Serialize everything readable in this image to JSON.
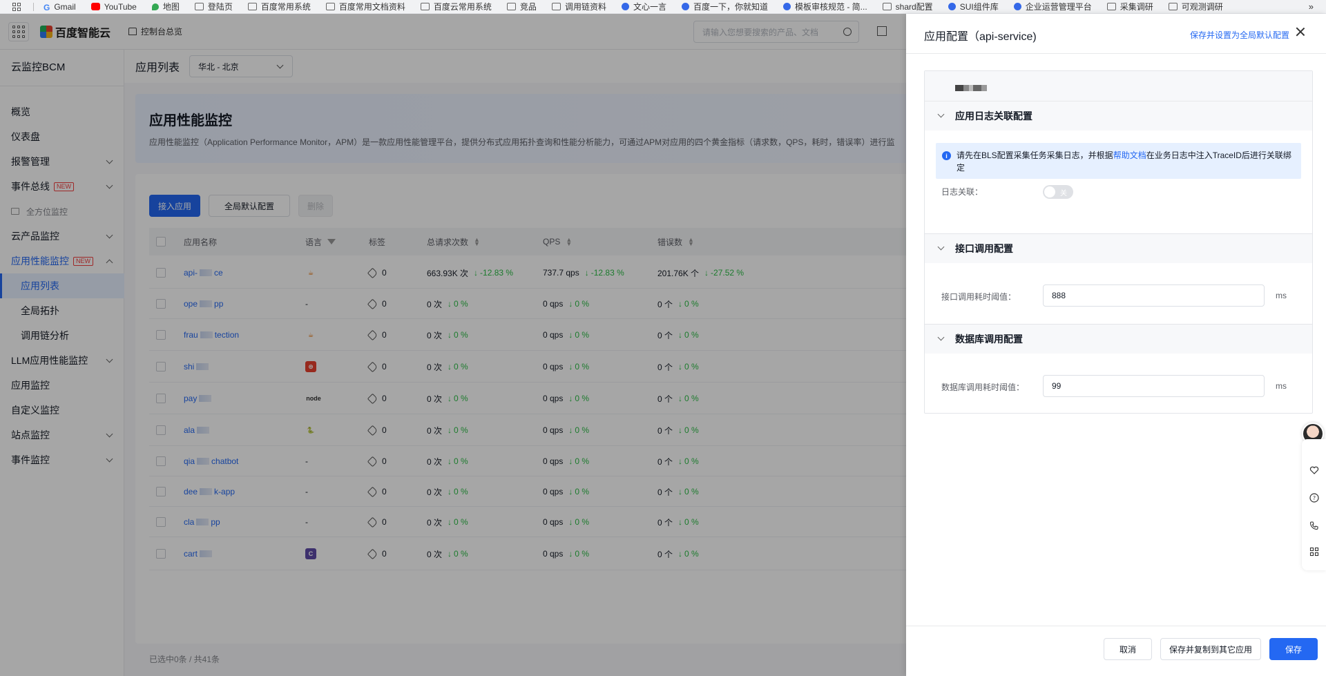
{
  "bookmarks": [
    "Gmail",
    "YouTube",
    "地图",
    "登陆页",
    "百度常用系统",
    "百度常用文档资料",
    "百度云常用系统",
    "竞品",
    "调用链资料",
    "文心一言",
    "百度一下，你就知道",
    "模板审核规范 - 简...",
    "shard配置",
    "SUI组件库",
    "企业运营管理平台",
    "采集调研",
    "可观测调研"
  ],
  "bookmarks_more": "»",
  "topbar": {
    "logo": "百度智能云",
    "console_home": "控制台总览",
    "search_placeholder": "请输入您想要搜索的产品、文档"
  },
  "sidebar": {
    "title": "云监控BCM",
    "items": [
      {
        "label": "概览"
      },
      {
        "label": "仪表盘"
      },
      {
        "label": "报警管理"
      },
      {
        "label": "事件总线",
        "badge": "NEW"
      },
      {
        "label": "全方位监控"
      },
      {
        "label": "云产品监控"
      },
      {
        "label": "应用性能监控",
        "badge": "NEW"
      },
      {
        "label": "应用列表"
      },
      {
        "label": "全局拓扑"
      },
      {
        "label": "调用链分析"
      },
      {
        "label": "LLM应用性能监控"
      },
      {
        "label": "应用监控"
      },
      {
        "label": "自定义监控"
      },
      {
        "label": "站点监控"
      },
      {
        "label": "事件监控"
      }
    ]
  },
  "page": {
    "title": "应用列表",
    "region": "华北 - 北京",
    "banner_title": "应用性能监控",
    "banner_desc": "应用性能监控（Application Performance Monitor，APM）是一款应用性能管理平台，提供分布式应用拓扑查询和性能分析能力，可通过APM对应用的四个黄金指标（请求数，QPS，耗时，错误率）进行监"
  },
  "toolbar": {
    "add_app": "接入应用",
    "global_default": "全局默认配置",
    "delete": "删除"
  },
  "table": {
    "headers": [
      "应用名称",
      "语言",
      "标签",
      "总请求次数",
      "QPS",
      "错误数"
    ],
    "rows": [
      {
        "name_a": "api-",
        "name_b": "ce",
        "lang": "java",
        "tags": "0",
        "requests": "663.93K 次",
        "req_change": "-12.83 %",
        "qps": "737.7 qps",
        "qps_change": "-12.83 %",
        "errors": "201.76K 个",
        "err_change": "-27.52 %"
      },
      {
        "name_a": "ope",
        "name_b": "pp",
        "lang": "-",
        "tags": "0",
        "requests": "0 次",
        "req_change": "0 %",
        "qps": "0 qps",
        "qps_change": "0 %",
        "errors": "0 个",
        "err_change": "0 %"
      },
      {
        "name_a": "frau",
        "name_b": "tection",
        "lang": "java",
        "tags": "0",
        "requests": "0 次",
        "req_change": "0 %",
        "qps": "0 qps",
        "qps_change": "0 %",
        "errors": "0 个",
        "err_change": "0 %"
      },
      {
        "name_a": "shi",
        "name_b": "",
        "lang": "go",
        "tags": "0",
        "requests": "0 次",
        "req_change": "0 %",
        "qps": "0 qps",
        "qps_change": "0 %",
        "errors": "0 个",
        "err_change": "0 %"
      },
      {
        "name_a": "pay",
        "name_b": "",
        "lang": "node",
        "tags": "0",
        "requests": "0 次",
        "req_change": "0 %",
        "qps": "0 qps",
        "qps_change": "0 %",
        "errors": "0 个",
        "err_change": "0 %"
      },
      {
        "name_a": "ala",
        "name_b": "",
        "lang": "python",
        "tags": "0",
        "requests": "0 次",
        "req_change": "0 %",
        "qps": "0 qps",
        "qps_change": "0 %",
        "errors": "0 个",
        "err_change": "0 %"
      },
      {
        "name_a": "qia",
        "name_b": "chatbot",
        "lang": "-",
        "tags": "0",
        "requests": "0 次",
        "req_change": "0 %",
        "qps": "0 qps",
        "qps_change": "0 %",
        "errors": "0 个",
        "err_change": "0 %"
      },
      {
        "name_a": "dee",
        "name_b": "k-app",
        "lang": "-",
        "tags": "0",
        "requests": "0 次",
        "req_change": "0 %",
        "qps": "0 qps",
        "qps_change": "0 %",
        "errors": "0 个",
        "err_change": "0 %"
      },
      {
        "name_a": "cla",
        "name_b": "pp",
        "lang": "-",
        "tags": "0",
        "requests": "0 次",
        "req_change": "0 %",
        "qps": "0 qps",
        "qps_change": "0 %",
        "errors": "0 个",
        "err_change": "0 %"
      },
      {
        "name_a": "cart",
        "name_b": "",
        "lang": "cpp",
        "tags": "0",
        "requests": "0 次",
        "req_change": "0 %",
        "qps": "0 qps",
        "qps_change": "0 %",
        "errors": "0 个",
        "err_change": "0 %"
      }
    ],
    "footer": "已选中0条 / 共41条"
  },
  "drawer": {
    "title": "应用配置（api-service)",
    "save_default": "保存并设置为全局默认配置",
    "sections": [
      {
        "title": "应用日志关联配置"
      },
      {
        "title": "接口调用配置"
      },
      {
        "title": "数据库调用配置"
      }
    ],
    "info_a": "请先在BLS配置采集任务采集日志，并根据",
    "info_link": "帮助文档",
    "info_b": "在业务日志中注入TraceID后进行关联绑定",
    "log_label": "日志关联：",
    "toggle_text": "关",
    "api_label": "接口调用耗时阈值：",
    "api_value": "888",
    "db_label": "数据库调用耗时阈值：",
    "db_value": "99",
    "unit": "ms",
    "cancel": "取消",
    "save_copy": "保存并复制到其它应用",
    "save": "保存"
  },
  "colors": {
    "accent": "#2468f2",
    "down": "#2bbd45",
    "new_badge": "#f33e3e"
  }
}
